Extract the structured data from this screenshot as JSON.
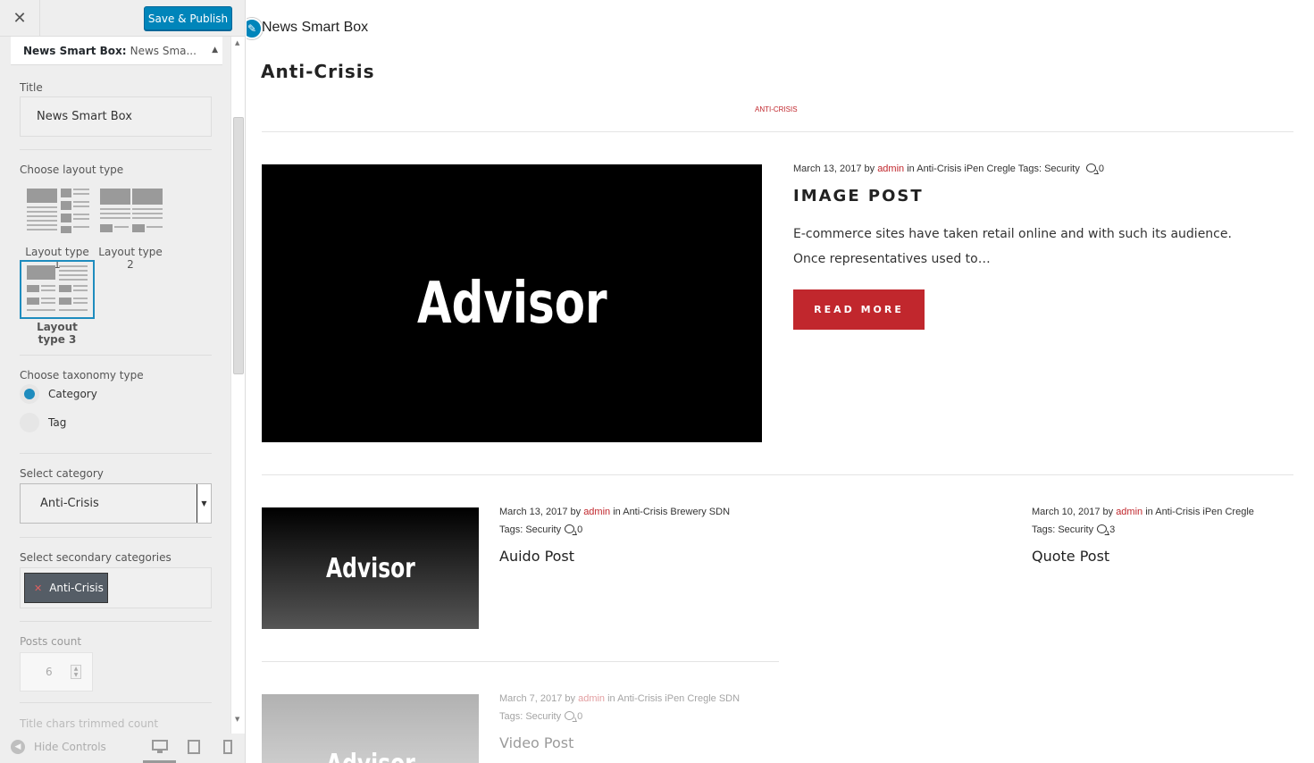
{
  "customizer": {
    "close_icon": "close-icon",
    "save_label": "Save & Publish",
    "section_bold": "News Smart Box:",
    "section_rest": "News Sma...",
    "title_label": "Title",
    "title_value": "News Smart Box",
    "layout_label": "Choose layout type",
    "layouts": [
      {
        "label": "Layout type 1",
        "selected": false
      },
      {
        "label": "Layout type 2",
        "selected": false
      },
      {
        "label": "Layout type 3",
        "selected": true
      }
    ],
    "taxonomy_label": "Choose taxonomy type",
    "taxonomy_options": [
      {
        "label": "Category",
        "checked": true
      },
      {
        "label": "Tag",
        "checked": false
      }
    ],
    "category_label": "Select category",
    "category_value": "Anti-Crisis",
    "secondary_label": "Select secondary categories",
    "secondary_chip": "Anti-Crisis",
    "posts_count_label": "Posts count",
    "posts_count_value": "6",
    "trim_label": "Title chars trimmed count",
    "hide_controls": "Hide Controls"
  },
  "preview": {
    "widget_title": "News Smart Box",
    "section_title": "Anti-Crisis",
    "category_tab": "ANTI-CRISIS",
    "featured": {
      "thumb_text": "Advisor",
      "date": "March 13, 2017",
      "by": "by",
      "author": "admin",
      "in": "in Anti-Crisis iPen Cregle",
      "tags": "Tags: Security",
      "comments": "0",
      "title": "IMAGE POST",
      "excerpt": "E-commerce sites have taken retail online and with such its audience. Once representatives used to…",
      "read_more": "READ MORE"
    },
    "posts": [
      {
        "thumb_text": "Advisor",
        "date": "March 13, 2017",
        "by": "by",
        "author": "admin",
        "in": "in Anti-Crisis Brewery SDN",
        "tags": "Tags: Security",
        "comments": "0",
        "title": "Auido Post"
      },
      {
        "date": "March 10, 2017",
        "by": "by",
        "author": "admin",
        "in": "in Anti-Crisis iPen Cregle",
        "tags": "Tags: Security",
        "comments": "3",
        "title": "Quote Post"
      },
      {
        "thumb_text": "Advisor",
        "date": "March 7, 2017",
        "by": "by",
        "author": "admin",
        "in": "in Anti-Crisis iPen Cregle SDN",
        "tags": "Tags: Security",
        "comments": "0",
        "title": "Video Post"
      }
    ]
  },
  "colors": {
    "accent": "#c1272d",
    "primary_button": "#0085ba"
  }
}
